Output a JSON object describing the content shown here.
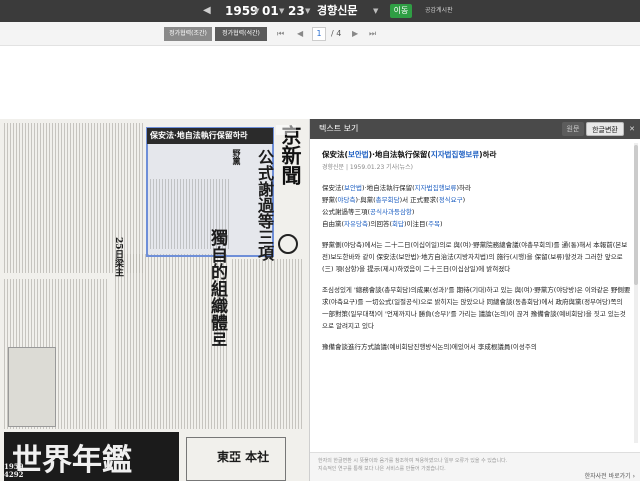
{
  "topbar": {
    "prev_arrow": "◀",
    "year": "1959",
    "month": "01",
    "day": "23",
    "next_arrow": "▶",
    "caret": "▼",
    "paper": "경향신문",
    "go_button": "이동",
    "notice": "공감계시판"
  },
  "section_tabs": [
    "정가협력(조간)",
    "정가협력(석간)"
  ],
  "pager": {
    "first": "⏮",
    "prev": "◀",
    "current": "1",
    "total": "/ 4",
    "next": "▶",
    "last": "⏭"
  },
  "newspaper": {
    "masthead": "京新聞",
    "headline_box": "保安法·地自法執行保留하라",
    "sub1": "公式謝過等三項",
    "sub2": "獨自的組織體로",
    "sub3": "25日梁主",
    "side": "野黨",
    "bottom_banner": "世界年鑑",
    "years": "1959 4292",
    "ad_text": "東亞 本社"
  },
  "panel": {
    "title": "텍스트 보기",
    "lang_hanja": "원문",
    "lang_korean": "한글변환",
    "article_title_a": "保安法(",
    "article_title_b": "보안법",
    "article_title_c": ")·地自法執行保留(",
    "article_title_d": "지자법집행보류",
    "article_title_e": ")하라",
    "article_meta": "경향신문 | 1959.01.23 기사(뉴스)",
    "para1": [
      {
        "t": "保安法(",
        "r": false
      },
      {
        "t": "보안법",
        "r": true
      },
      {
        "t": ")·地自法執行保留(",
        "r": false
      },
      {
        "t": "지자법집행보류",
        "r": true
      },
      {
        "t": ")하라",
        "r": false
      }
    ],
    "para1b": [
      {
        "t": "野黨(",
        "r": false
      },
      {
        "t": "야당측",
        "r": true
      },
      {
        "t": ")·與黨(",
        "r": false
      },
      {
        "t": "총무회담",
        "r": true
      },
      {
        "t": ")서 正式要求(",
        "r": false
      },
      {
        "t": "정식요구",
        "r": true
      },
      {
        "t": ")",
        "r": false
      }
    ],
    "para1c": [
      {
        "t": "公式謝過等三項(",
        "r": false
      },
      {
        "t": "공식사과등삼항",
        "r": true
      },
      {
        "t": ")",
        "r": false
      }
    ],
    "para1d": [
      {
        "t": "自由黨(",
        "r": false
      },
      {
        "t": "자유당측",
        "r": true
      },
      {
        "t": ")의回答(",
        "r": false
      },
      {
        "t": "회답",
        "r": true
      },
      {
        "t": ")이注目(",
        "r": false
      },
      {
        "t": "주목",
        "r": true
      },
      {
        "t": ")",
        "r": false
      }
    ],
    "para2": "野黨側(야당측)에서는 二十二日(이십이일)의로 與(여)·野黨院務總會議(야총무회의)를 通(통)해서 本報前(본보전)보도한바와 같이 保安法(보안법)·地方自治法(지방자치법)의 施行(시행)을 保留(보류)할것과 그러한 앞으로 (三) 項(삼항)을 提示(제시)하였음이 二十三日(이십삼일)에 밝혀졌다",
    "para3": "조심성있게 '總務會談(총무회담)의成果(성과)'를 期待(기대)하고 있는 與(여)·野黨方(야당방)은 이와같은 野側要求(야측요구)를 一切公式(일절공식)으로 밝히지는 않았으나 同總會談(동총회담)에서 政府與黨(정부여당)쪽의 一部對策(일부대책)이 '언제까지나 勝負(승부)'를 가리는 議論(논의)이 끊겨 豫備會談(예비회담)을 짓고 있는것으로 알려지고 있다",
    "para4": "豫備會談進行方式論議(예비회담진행방식논의)에있어서 李成根議員(이성주의",
    "footer1": "한자의 한글변환 시 뜻풀이와 음가를 참조하여 적용하였으나 일부 오류가 있을 수 있습니다.",
    "footer2": "지속적인 연구를 통해 보다 나은 서비스를 만들어 가겠습니다.",
    "guide": "한자사전 바로가기 ›"
  },
  "colors": {
    "topbar": "#3b3b3b",
    "link_red": "#1d5fc2",
    "go_green": "#2f9e44",
    "highlight": "#6f8fd8"
  }
}
